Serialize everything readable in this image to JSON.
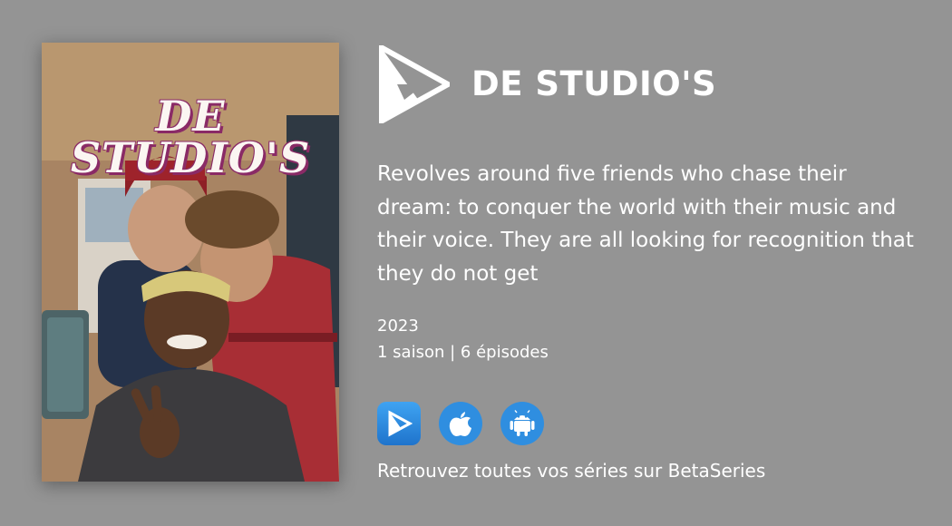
{
  "poster": {
    "title_text": "DE STUDIO'S"
  },
  "header": {
    "logo_icon": "betaseries-play-logo-icon",
    "title": "DE STUDIO'S"
  },
  "description": "Revolves around five friends who chase their dream: to conquer the world with their music and their voice. They are all looking for recognition that they do not get",
  "meta": {
    "year": "2023",
    "seasons_episodes": "1 saison | 6 épisodes"
  },
  "apps": [
    {
      "icon": "betaseries-app-icon"
    },
    {
      "icon": "apple-icon"
    },
    {
      "icon": "android-icon"
    }
  ],
  "footer": {
    "text": "Retrouvez toutes vos séries sur BetaSeries"
  },
  "colors": {
    "background": "#949494",
    "accent_blue": "#2f8ee0",
    "poster_title_outline": "#8a2a66"
  }
}
